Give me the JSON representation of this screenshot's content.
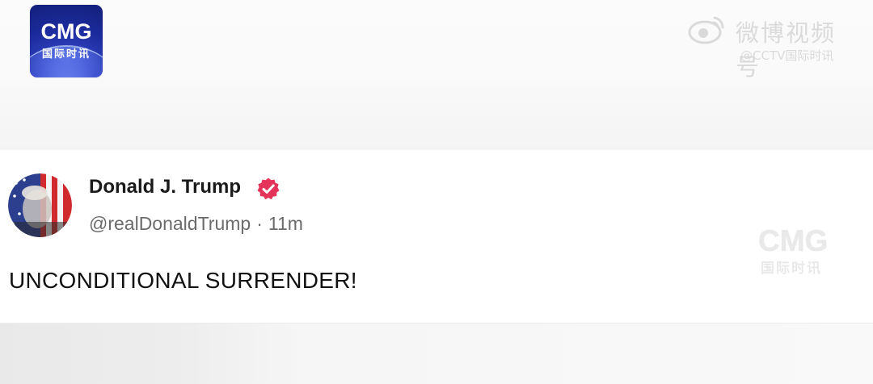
{
  "logo": {
    "brand": "CMG",
    "subtitle": "国际时讯",
    "colors": {
      "background": "#1a2a9a",
      "text": "#ffffff"
    }
  },
  "watermark": {
    "platform": "微博视频号",
    "handle": "@CCTV国际时讯",
    "icon": "weibo-eye-icon"
  },
  "tweet": {
    "display_name": "Donald J. Trump",
    "verified_icon": "verified-badge-icon",
    "verified_color": "#e5345a",
    "handle": "@realDonaldTrump",
    "separator": "·",
    "time": "11m",
    "text": "UNCONDITIONAL SURRENDER!"
  },
  "corner_watermark": {
    "brand": "CMG",
    "subtitle": "国际时讯"
  }
}
